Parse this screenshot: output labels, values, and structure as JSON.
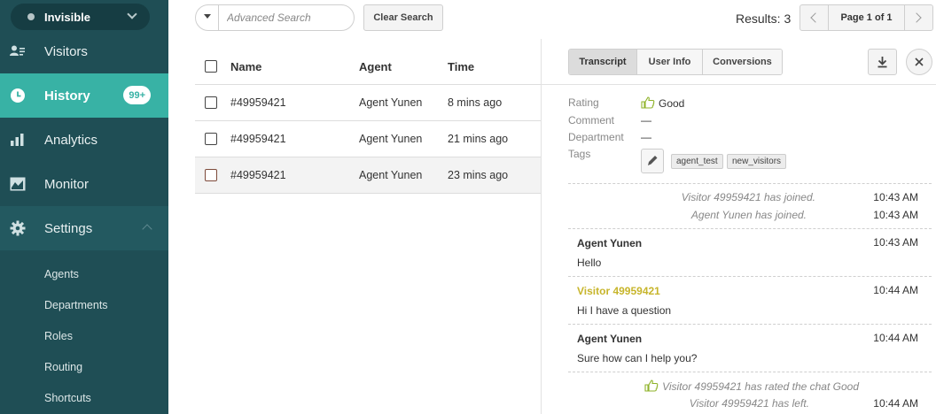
{
  "status": {
    "label": "Invisible"
  },
  "nav": {
    "visitors": "Visitors",
    "history": "History",
    "history_badge": "99+",
    "analytics": "Analytics",
    "monitor": "Monitor",
    "settings": "Settings"
  },
  "subnav": [
    "Agents",
    "Departments",
    "Roles",
    "Routing",
    "Shortcuts"
  ],
  "toolbar": {
    "search_placeholder": "Advanced Search",
    "clear_label": "Clear Search",
    "results": "Results: 3",
    "page_label": "Page 1 of 1"
  },
  "table": {
    "headers": {
      "name": "Name",
      "agent": "Agent",
      "time": "Time"
    },
    "rows": [
      {
        "name": "#49959421",
        "agent": "Agent Yunen",
        "time": "8 mins ago"
      },
      {
        "name": "#49959421",
        "agent": "Agent Yunen",
        "time": "21 mins ago"
      },
      {
        "name": "#49959421",
        "agent": "Agent Yunen",
        "time": "23 mins ago"
      }
    ]
  },
  "panel": {
    "tabs": [
      "Transcript",
      "User Info",
      "Conversions"
    ],
    "info": {
      "rating_label": "Rating",
      "rating_value": "Good",
      "comment_label": "Comment",
      "comment_value": "—",
      "department_label": "Department",
      "department_value": "—",
      "tags_label": "Tags",
      "tags": [
        "agent_test",
        "new_visitors"
      ]
    },
    "transcript": {
      "system1": {
        "text": "Visitor 49959421 has joined.",
        "time": "10:43 AM"
      },
      "system2": {
        "text": "Agent Yunen has joined.",
        "time": "10:43 AM"
      },
      "messages": [
        {
          "author": "Agent Yunen",
          "text": "Hello",
          "time": "10:43 AM"
        },
        {
          "author": "Visitor 49959421",
          "text": "Hi I have a question",
          "time": "10:44 AM"
        },
        {
          "author": "Agent Yunen",
          "text": "Sure how can I help you?",
          "time": "10:44 AM"
        }
      ],
      "system3": {
        "text": "Visitor 49959421 has rated the chat Good"
      },
      "system4": {
        "text": "Visitor 49959421 has left.",
        "time": "10:44 AM"
      }
    }
  },
  "colors": {
    "sidebar": "#1f4e55",
    "accent": "#38b2a5",
    "visitor": "#c7b52b",
    "rating_icon": "#8fb32a"
  }
}
